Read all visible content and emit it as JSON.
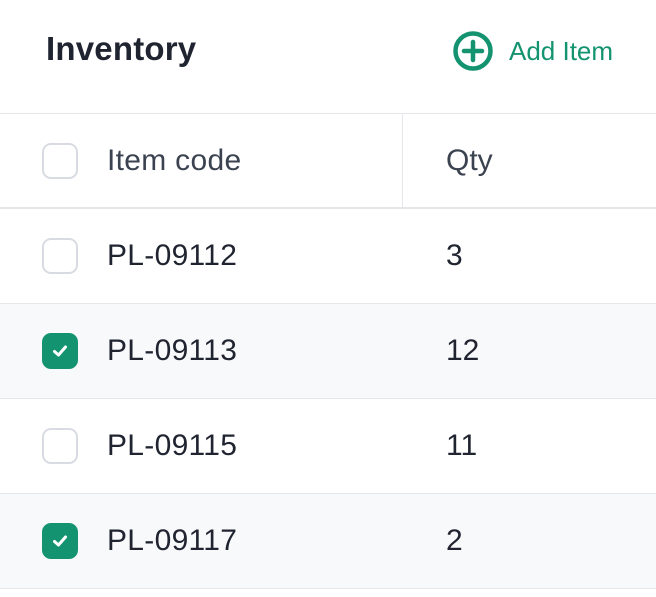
{
  "header": {
    "title": "Inventory",
    "add_button_label": "Add Item",
    "add_icon": "plus-circle-icon"
  },
  "table": {
    "columns": [
      "Item code",
      "Qty"
    ],
    "rows": [
      {
        "code": "PL-09112",
        "qty": "3",
        "checked": false
      },
      {
        "code": "PL-09113",
        "qty": "12",
        "checked": true
      },
      {
        "code": "PL-09115",
        "qty": "11",
        "checked": false
      },
      {
        "code": "PL-09117",
        "qty": "2",
        "checked": true
      }
    ]
  },
  "colors": {
    "accent": "#149370",
    "row_stripe": "#f8f9fb",
    "border": "#e5e7eb"
  }
}
